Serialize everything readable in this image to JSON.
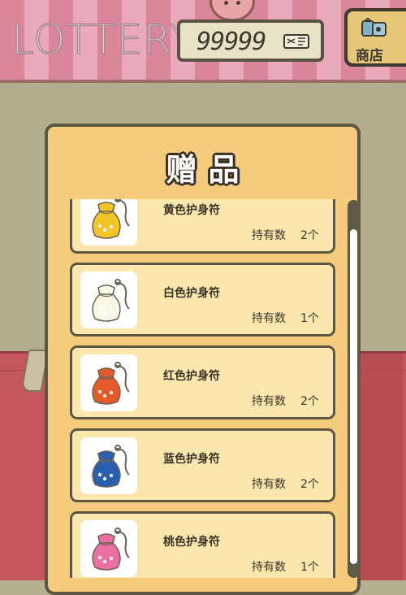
{
  "header": {
    "title": "LOTTERY",
    "ticket_count": "99999",
    "shop_label": "商店"
  },
  "dialog": {
    "title": "赠品",
    "items": [
      {
        "name": "黄色护身符",
        "qty_label": "持有数",
        "qty": "2个",
        "charm_color": "#f2c428",
        "icon": "yellow-charm-pouch-icon"
      },
      {
        "name": "白色护身符",
        "qty_label": "持有数",
        "qty": "1个",
        "charm_color": "#fbf6e6",
        "icon": "white-charm-pouch-icon"
      },
      {
        "name": "红色护身符",
        "qty_label": "持有数",
        "qty": "2个",
        "charm_color": "#e55a2b",
        "icon": "red-charm-pouch-icon"
      },
      {
        "name": "蓝色护身符",
        "qty_label": "持有数",
        "qty": "2个",
        "charm_color": "#2a5fb0",
        "icon": "blue-charm-pouch-icon"
      },
      {
        "name": "桃色护身符",
        "qty_label": "持有数",
        "qty": "1个",
        "charm_color": "#ec6fa4",
        "icon": "pink-charm-pouch-icon"
      }
    ]
  },
  "colors": {
    "panel": "#f5cc7b",
    "card": "#fbe6ad",
    "border": "#5c5643"
  }
}
